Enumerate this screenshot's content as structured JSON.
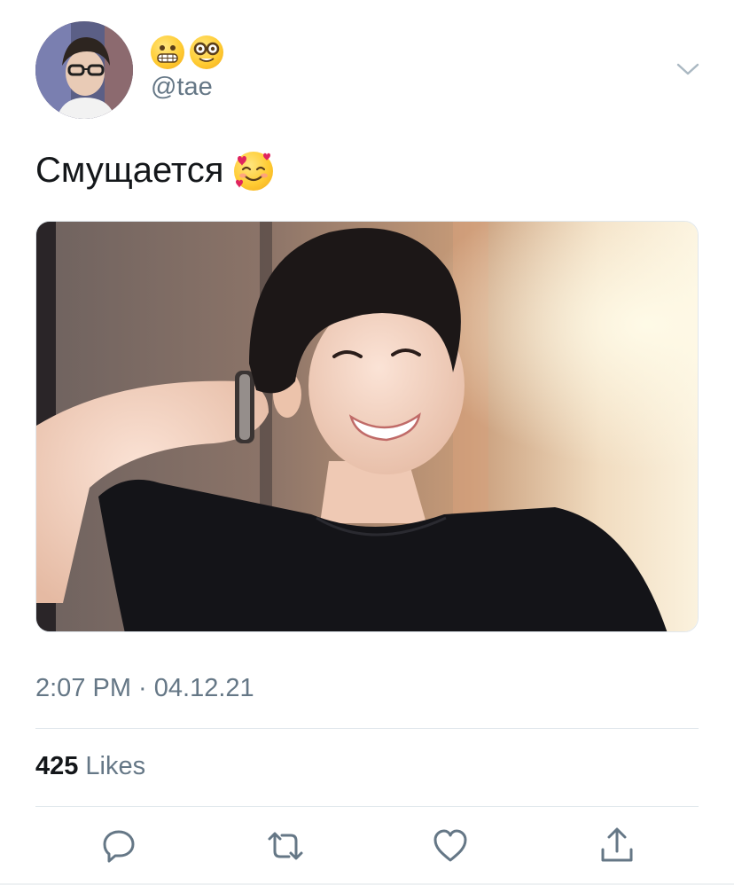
{
  "author": {
    "handle": "@tae",
    "name_emojis": [
      "grimacing-face-emoji",
      "nerd-face-emoji"
    ],
    "avatar": "profile-photo"
  },
  "tweet": {
    "text": "Смущается",
    "text_emoji": "smiling-face-with-hearts-emoji",
    "media": "photo-smiling-person-black-tshirt",
    "timestamp": "2:07 PM · 04.12.21"
  },
  "stats": {
    "likes_count": "425",
    "likes_label": "Likes"
  },
  "actions": [
    {
      "name": "reply",
      "icon": "comment-icon"
    },
    {
      "name": "retweet",
      "icon": "retweet-icon"
    },
    {
      "name": "like",
      "icon": "heart-icon"
    },
    {
      "name": "share",
      "icon": "share-icon"
    }
  ],
  "colors": {
    "text_primary": "#14171a",
    "text_secondary": "#657786",
    "divider": "#e1e8ed",
    "icon": "#657786"
  }
}
